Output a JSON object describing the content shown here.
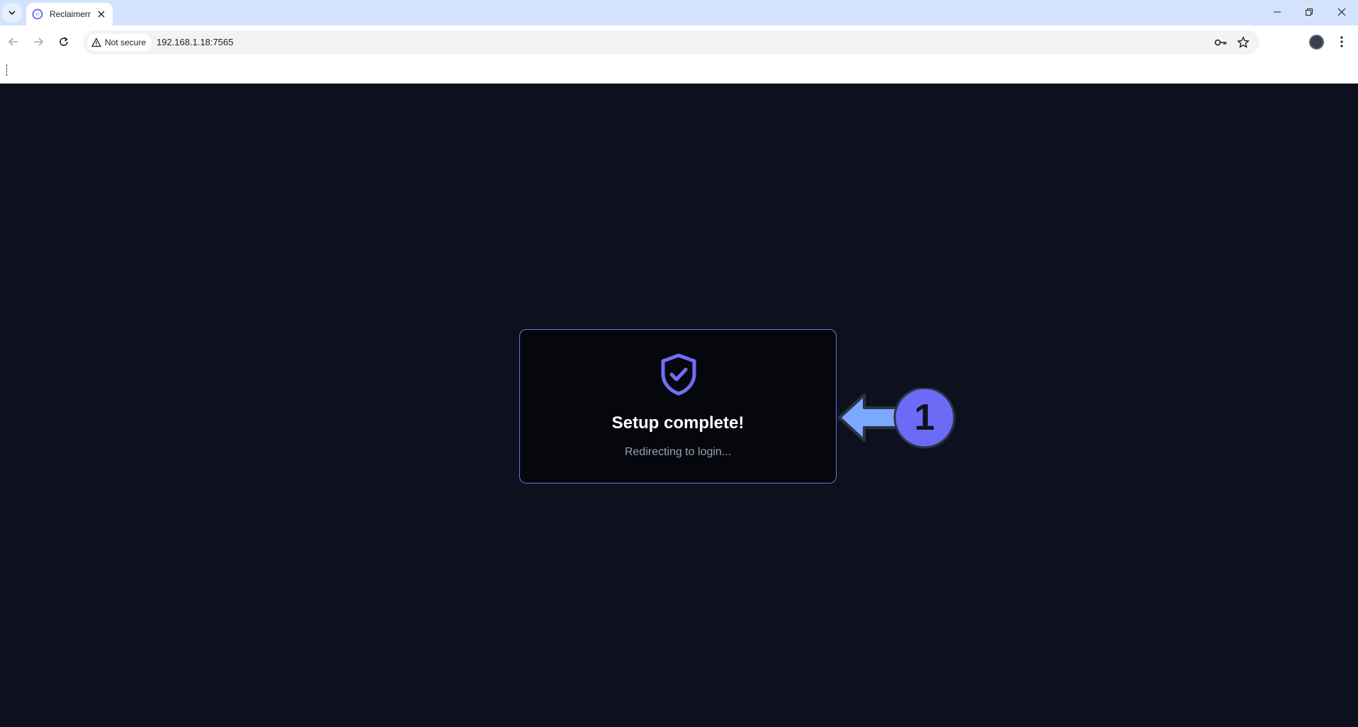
{
  "browser": {
    "tab": {
      "title": "Reclaimerr"
    },
    "address_bar": {
      "security_label": "Not secure",
      "url": "192.168.1.18:7565"
    }
  },
  "setup_card": {
    "title": "Setup complete!",
    "subtitle": "Redirecting to login..."
  },
  "annotation": {
    "step_number": "1"
  },
  "colors": {
    "accent": "#6f6ff2",
    "background": "#0d111e",
    "card_background": "#05070d",
    "annotation_arrow": "#7ca8ff",
    "annotation_badge": "#6b6bf5"
  },
  "icons": {
    "shield": "shield-check-icon",
    "arrow": "left-arrow-icon"
  }
}
